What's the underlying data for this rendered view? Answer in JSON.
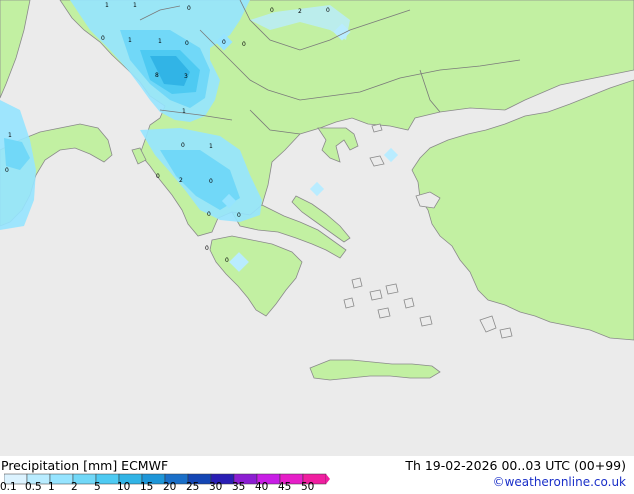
{
  "footer": {
    "title": "Precipitation [mm] ECMWF",
    "validity": "Th 19-02-2026 00..03 UTC (00+99)",
    "credit": "©weatheronline.co.uk"
  },
  "legend": {
    "ticks": [
      "0.1",
      "0.5",
      "1",
      "2",
      "5",
      "10",
      "15",
      "20",
      "25",
      "30",
      "35",
      "40",
      "45",
      "50"
    ],
    "colors": [
      "#dcf3ff",
      "#b9ecff",
      "#96e4ff",
      "#71d8f8",
      "#4ecaf2",
      "#31b4e6",
      "#1e96d8",
      "#1a6fc8",
      "#1446b4",
      "#2a1eb4",
      "#8c1ed2",
      "#c81ee6",
      "#e61ec8",
      "#f01ea0"
    ]
  },
  "map": {
    "colors": {
      "sea": "#ebebeb",
      "land": "#c2f0a2",
      "coast": "#8a8a8a",
      "border": "#7a7a7a"
    },
    "labels": [
      "1",
      "1",
      "0",
      "0",
      "2",
      "0",
      "0",
      "1",
      "1",
      "0",
      "0",
      "0",
      "8",
      "3",
      "1",
      "1",
      "0",
      "1",
      "0",
      "0",
      "2",
      "0",
      "0",
      "0",
      "0",
      "0"
    ]
  }
}
